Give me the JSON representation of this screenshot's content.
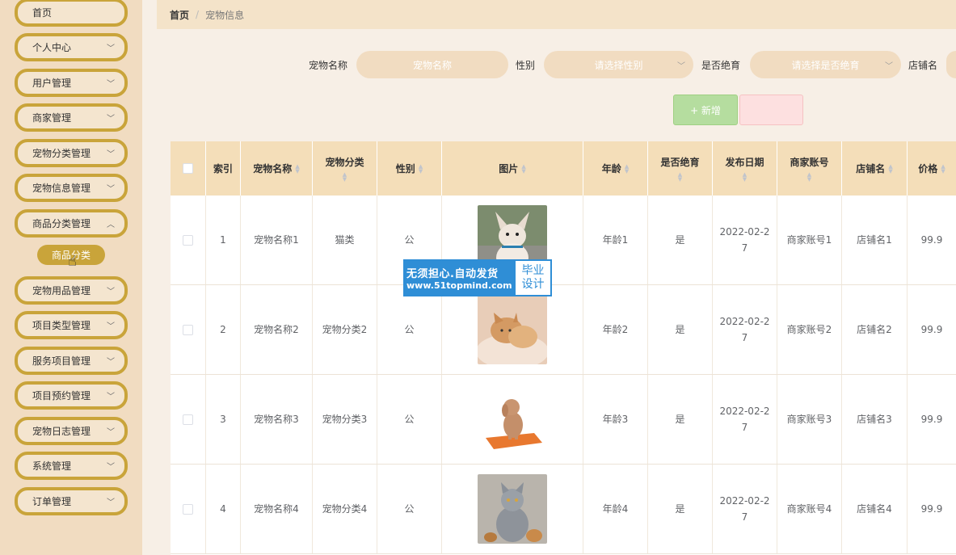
{
  "sidebar": {
    "items": [
      {
        "label": "首页",
        "has_arrow": false
      },
      {
        "label": "个人中心",
        "has_arrow": true
      },
      {
        "label": "用户管理",
        "has_arrow": true
      },
      {
        "label": "商家管理",
        "has_arrow": true
      },
      {
        "label": "宠物分类管理",
        "has_arrow": true
      },
      {
        "label": "宠物信息管理",
        "has_arrow": true
      },
      {
        "label": "商品分类管理",
        "has_arrow": true
      },
      {
        "label": "宠物用品管理",
        "has_arrow": true
      },
      {
        "label": "项目类型管理",
        "has_arrow": true
      },
      {
        "label": "服务项目管理",
        "has_arrow": true
      },
      {
        "label": "项目预约管理",
        "has_arrow": true
      },
      {
        "label": "宠物日志管理",
        "has_arrow": true
      },
      {
        "label": "系统管理",
        "has_arrow": true
      },
      {
        "label": "订单管理",
        "has_arrow": true
      }
    ],
    "submenu_active": "商品分类"
  },
  "breadcrumb": {
    "home": "首页",
    "separator": "/",
    "current": "宠物信息"
  },
  "search": {
    "name_label": "宠物名称",
    "name_placeholder": "宠物名称",
    "gender_label": "性别",
    "gender_placeholder": "请选择性别",
    "sterilized_label": "是否绝育",
    "sterilized_placeholder": "请选择是否绝育",
    "shop_label": "店铺名"
  },
  "buttons": {
    "add": "+ 新增",
    "delete": ""
  },
  "table": {
    "headers": {
      "index": "索引",
      "name": "宠物名称",
      "category": "宠物分类",
      "gender": "性别",
      "image": "图片",
      "age": "年龄",
      "sterilized": "是否绝育",
      "date": "发布日期",
      "merchant": "商家账号",
      "shop": "店铺名",
      "price": "价格"
    },
    "rows": [
      {
        "index": "1",
        "name": "宠物名称1",
        "category": "猫类",
        "gender": "公",
        "image": "french-bulldog-photo",
        "age": "年龄1",
        "sterilized": "是",
        "date_l1": "2022-02-2",
        "date_l2": "7",
        "merchant": "商家账号1",
        "shop": "店铺名1",
        "price": "99.9"
      },
      {
        "index": "2",
        "name": "宠物名称2",
        "category": "宠物分类2",
        "gender": "公",
        "image": "kittens-photo",
        "age": "年龄2",
        "sterilized": "是",
        "date_l1": "2022-02-2",
        "date_l2": "7",
        "merchant": "商家账号2",
        "shop": "店铺名2",
        "price": "99.9"
      },
      {
        "index": "3",
        "name": "宠物名称3",
        "category": "宠物分类3",
        "gender": "公",
        "image": "poodle-photo",
        "age": "年龄3",
        "sterilized": "是",
        "date_l1": "2022-02-2",
        "date_l2": "7",
        "merchant": "商家账号3",
        "shop": "店铺名3",
        "price": "99.9"
      },
      {
        "index": "4",
        "name": "宠物名称4",
        "category": "宠物分类4",
        "gender": "公",
        "image": "grey-cat-photo",
        "age": "年龄4",
        "sterilized": "是",
        "date_l1": "2022-02-2",
        "date_l2": "7",
        "merchant": "商家账号4",
        "shop": "店铺名4",
        "price": "99.9"
      }
    ]
  },
  "watermark": {
    "line1": "无须担心.自动发货",
    "line2": "www.51topmind.com",
    "badge1": "毕业",
    "badge2": "设计"
  },
  "colors": {
    "sidebar_bg": "#f1dcc1",
    "accent": "#c9a43a",
    "header_bg": "#f4deb9"
  }
}
